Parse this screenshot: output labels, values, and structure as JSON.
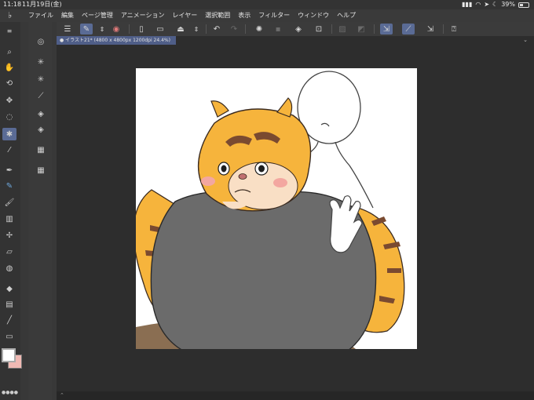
{
  "status_bar": {
    "time": "11:18",
    "date": "11月19日(金)",
    "battery": "39%"
  },
  "menu": {
    "items": [
      "ファイル",
      "編集",
      "ページ管理",
      "アニメーション",
      "レイヤー",
      "選択範囲",
      "表示",
      "フィルター",
      "ウィンドウ",
      "ヘルプ"
    ]
  },
  "tab": {
    "title": "● イラスト21* (4800 x 4800px 1200dpi 24.4%)"
  },
  "colors": {
    "accent": "#5a6b95",
    "main_color": "#ffffff",
    "sub_color": "#f0b9b4"
  },
  "icons": {
    "main_tools": [
      "zoom-icon",
      "hand-icon",
      "rotate-icon",
      "move-icon",
      "lasso-icon",
      "magic-wand-icon",
      "eyedropper-icon",
      "pen-icon",
      "pencil-icon",
      "brush-icon",
      "airbrush-icon",
      "decoration-icon",
      "eraser-icon",
      "blend-icon",
      "fill-icon",
      "gradient-icon",
      "figure-icon",
      "frame-icon",
      "ruler-icon"
    ],
    "sub_tools": [
      "sub-tool-detail-icon",
      "sparkle-icon",
      "sparkle-2-icon",
      "feather-icon",
      "layer-icon",
      "layers-icon",
      "material-icon",
      "material-2-icon"
    ]
  }
}
